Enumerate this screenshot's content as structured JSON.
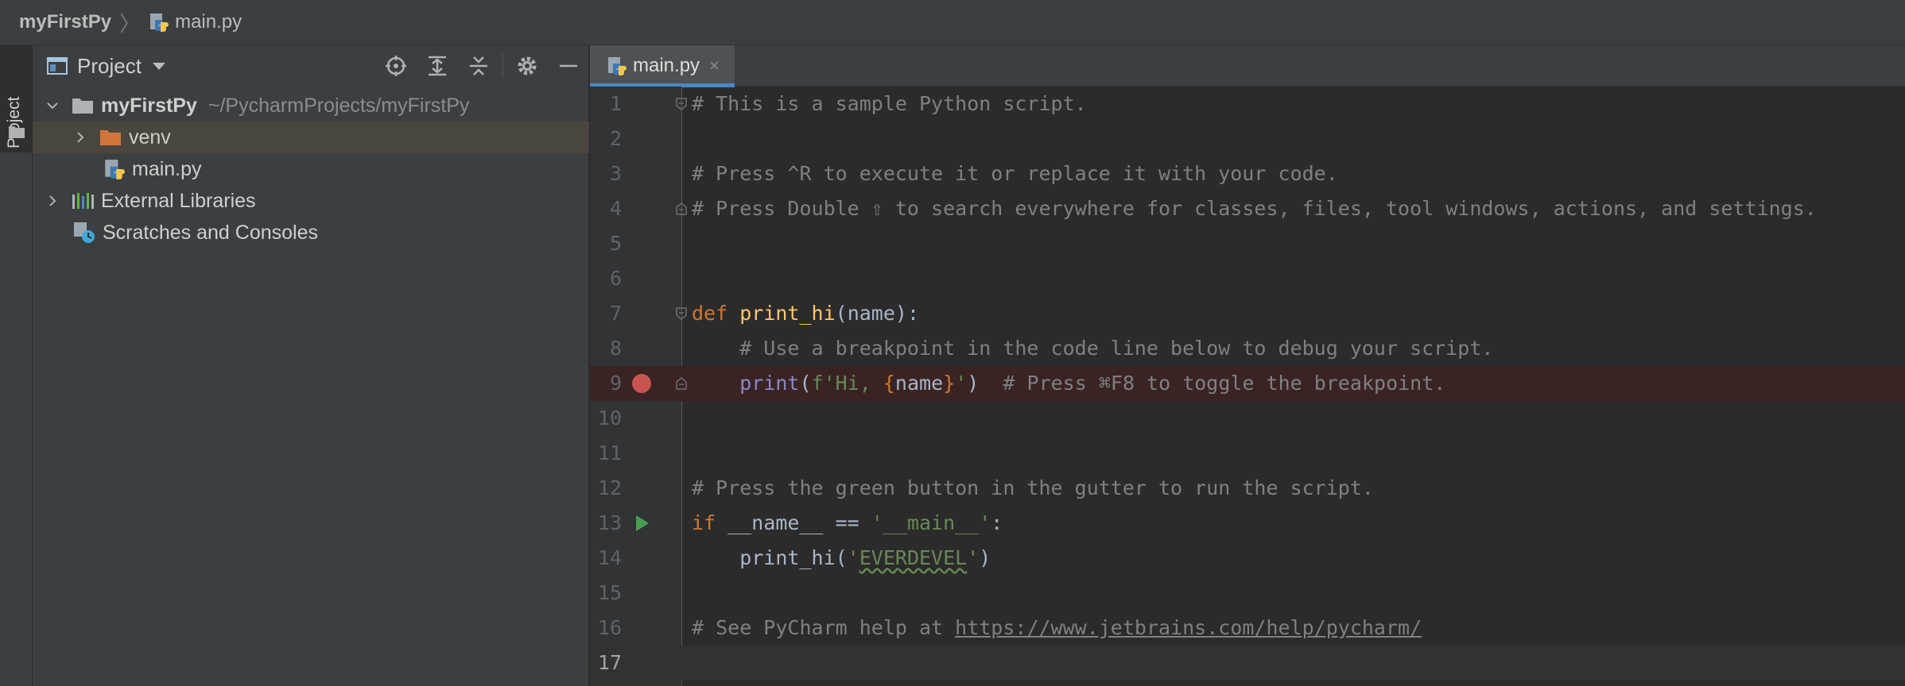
{
  "navbar": {
    "project": "myFirstPy",
    "file": "main.py"
  },
  "toolstrip": {
    "project_label": "Project"
  },
  "project_panel": {
    "title": "Project",
    "tree": [
      {
        "label": "myFirstPy",
        "path": "~/PycharmProjects/myFirstPy",
        "expanded": true,
        "icon": "folder-icon"
      },
      {
        "label": "venv",
        "expanded": false,
        "icon": "folder-icon",
        "selected": true
      },
      {
        "label": "main.py",
        "icon": "python-file-icon"
      },
      {
        "label": "External Libraries",
        "expanded": false,
        "icon": "libraries-icon"
      },
      {
        "label": "Scratches and Consoles",
        "icon": "scratches-icon"
      }
    ]
  },
  "editor": {
    "tab": {
      "label": "main.py",
      "close": "×"
    },
    "line_numbers": [
      "1",
      "2",
      "3",
      "4",
      "5",
      "6",
      "7",
      "8",
      "9",
      "10",
      "11",
      "12",
      "13",
      "14",
      "15",
      "16",
      "17"
    ],
    "lines": {
      "l1": "# This is a sample Python script.",
      "l3": "# Press ^R to execute it or replace it with your code.",
      "l4": "# Press Double ⇧ to search everywhere for classes, files, tool windows, actions, and settings.",
      "l7_def": "def",
      "l7_fn": "print_hi",
      "l7_rest": "(name):",
      "l8": "    # Use a breakpoint in the code line below to debug your script.",
      "l9_indent": "    ",
      "l9_print": "print",
      "l9_open": "(",
      "l9_fstr1": "f'Hi, ",
      "l9_brace_open": "{",
      "l9_name": "name",
      "l9_brace_close": "}",
      "l9_fstr2": "'",
      "l9_close": ")",
      "l9_comment": "  # Press ⌘F8 to toggle the breakpoint.",
      "l12": "# Press the green button in the gutter to run the script.",
      "l13_if": "if",
      "l13_mid": " __name__ == ",
      "l13_str": "'__main__'",
      "l13_end": ":",
      "l14_call": "    print_hi(",
      "l14_q1": "'",
      "l14_word": "EVERDEVEL",
      "l14_q2": "'",
      "l14_end": ")",
      "l16_text": "# See PyCharm help at ",
      "l16_link": "https://www.jetbrains.com/help/pycharm/"
    }
  },
  "colors": {
    "breakpoint": "#c75450",
    "run_gutter": "#499c54",
    "tab_underline": "#4a88c7"
  }
}
